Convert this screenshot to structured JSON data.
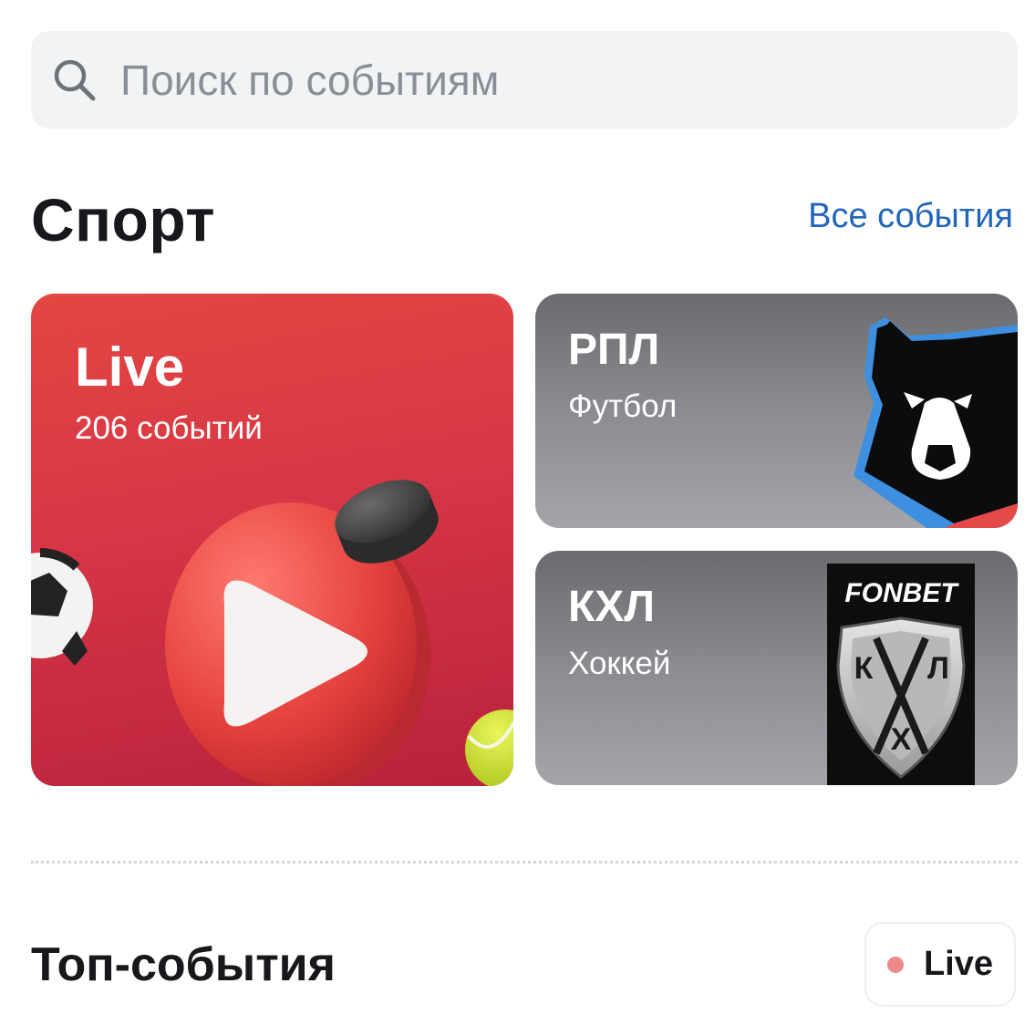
{
  "search": {
    "placeholder": "Поиск по событиям",
    "value": ""
  },
  "sport": {
    "title": "Спорт",
    "all_events_link": "Все события",
    "cards": [
      {
        "title": "Live",
        "subtitle": "206 событий"
      },
      {
        "title": "РПЛ",
        "subtitle": "Футбол"
      },
      {
        "title": "КХЛ",
        "subtitle": "Хоккей",
        "logo_text": "FONBET",
        "logo_letters": [
          "К",
          "Л",
          "Х"
        ]
      }
    ]
  },
  "top_events": {
    "title": "Топ-события",
    "live_chip_label": "Live"
  },
  "colors": {
    "accent_link": "#2266bb",
    "live_card": "#d63645",
    "live_dot": "#ee8a8a"
  }
}
